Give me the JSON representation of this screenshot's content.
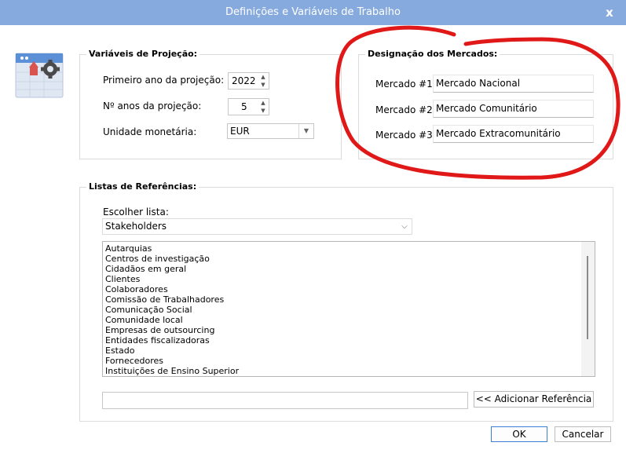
{
  "window": {
    "title": "Definições e Variáveis de Trabalho",
    "close_label": "x"
  },
  "projection": {
    "legend": "Variáveis de Projeção:",
    "first_year_label": "Primeiro ano da projeção:",
    "first_year_value": "2022",
    "num_years_label": "Nº anos da projeção:",
    "num_years_value": "5",
    "currency_label": "Unidade monetária:",
    "currency_value": "EUR"
  },
  "markets": {
    "legend": "Designação dos Mercados:",
    "items": [
      {
        "label": "Mercado #1",
        "value": "Mercado Nacional"
      },
      {
        "label": "Mercado #2",
        "value": "Mercado Comunitário"
      },
      {
        "label": "Mercado #3",
        "value": "Mercado Extracomunitário"
      }
    ]
  },
  "references": {
    "legend": "Listas de Referências:",
    "choose_label": "Escolher lista:",
    "selected_list": "Stakeholders",
    "items": [
      "Autarquias",
      "Centros de investigação",
      "Cidadãos em geral",
      "Clientes",
      "Colaboradores",
      "Comissão de Trabalhadores",
      "Comunicação Social",
      "Comunidade local",
      "Empresas de outsourcing",
      "Entidades fiscalizadoras",
      "Estado",
      "Fornecedores",
      "Instituições de Ensino Superior"
    ],
    "new_reference_value": "",
    "add_button": "<< Adicionar Referência"
  },
  "footer": {
    "ok": "OK",
    "cancel": "Cancelar"
  },
  "icons": {
    "app": "calendar-gear-icon",
    "spin": "spin-up-down-icon",
    "dropdown": "chevron-down-icon",
    "close": "close-icon"
  },
  "colors": {
    "titlebar": "#86aadd",
    "annotation": "#e01818",
    "ok_border": "#3c7fd6"
  }
}
